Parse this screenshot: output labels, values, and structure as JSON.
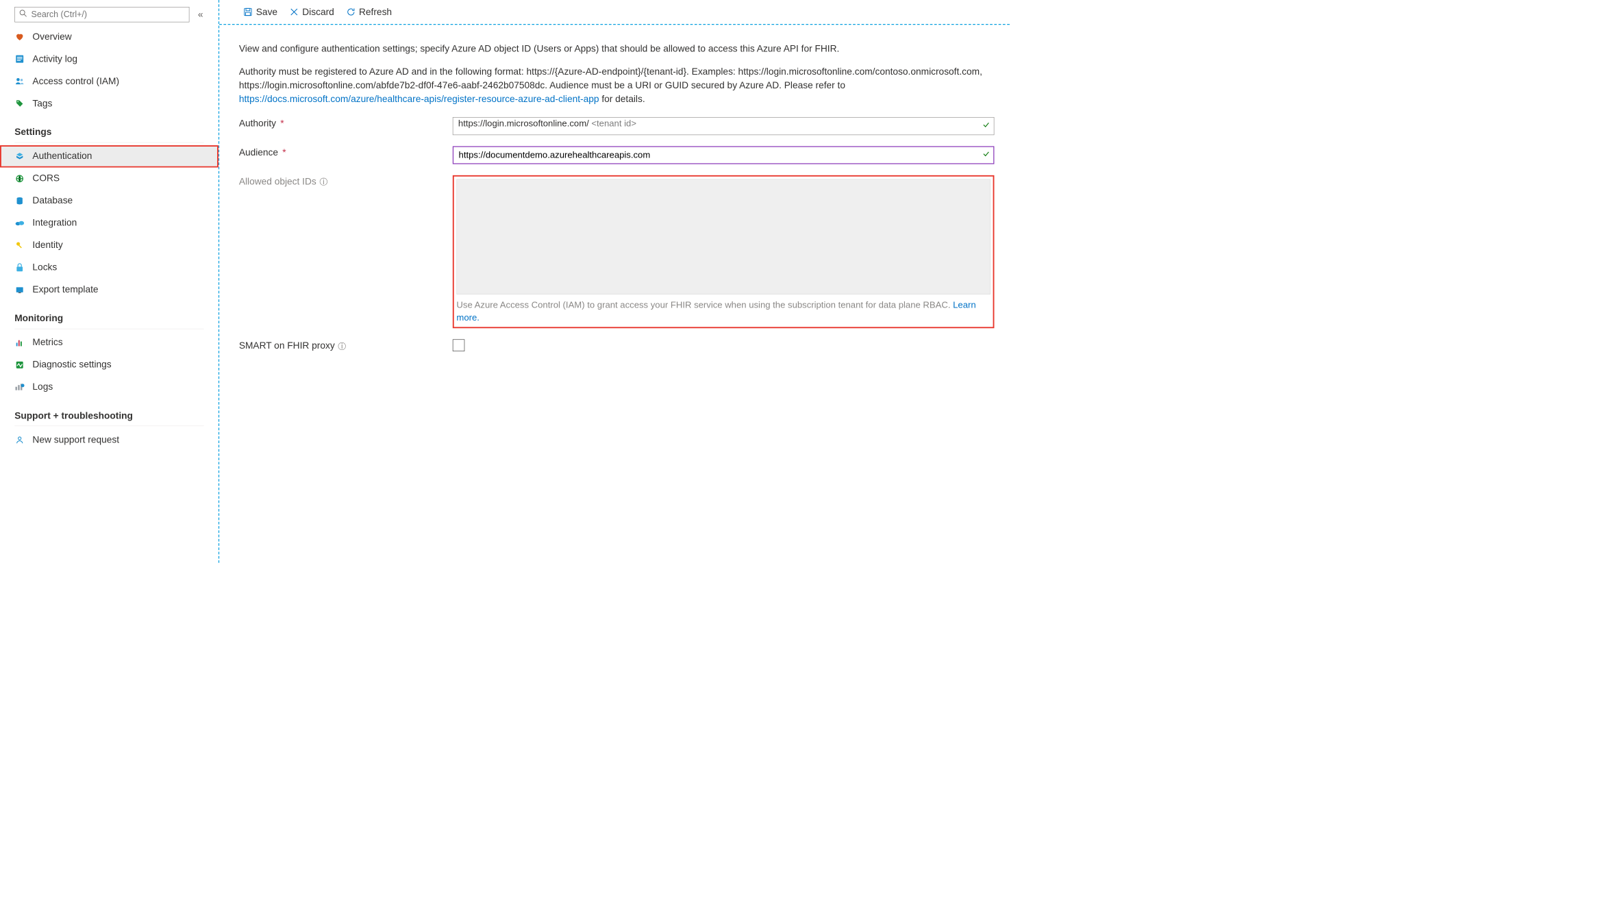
{
  "search": {
    "placeholder": "Search (Ctrl+/)"
  },
  "nav": {
    "top": [
      {
        "label": "Overview"
      },
      {
        "label": "Activity log"
      },
      {
        "label": "Access control (IAM)"
      },
      {
        "label": "Tags"
      }
    ],
    "settings_header": "Settings",
    "settings": [
      {
        "label": "Authentication"
      },
      {
        "label": "CORS"
      },
      {
        "label": "Database"
      },
      {
        "label": "Integration"
      },
      {
        "label": "Identity"
      },
      {
        "label": "Locks"
      },
      {
        "label": "Export template"
      }
    ],
    "monitoring_header": "Monitoring",
    "monitoring": [
      {
        "label": "Metrics"
      },
      {
        "label": "Diagnostic settings"
      },
      {
        "label": "Logs"
      }
    ],
    "support_header": "Support + troubleshooting",
    "support": [
      {
        "label": "New support request"
      }
    ]
  },
  "toolbar": {
    "save": "Save",
    "discard": "Discard",
    "refresh": "Refresh"
  },
  "intro1": "View and configure authentication settings; specify Azure AD object ID (Users or Apps) that should be allowed to access this Azure API for FHIR.",
  "intro2a": "Authority must be registered to Azure AD and in the following format: https://{Azure-AD-endpoint}/{tenant-id}. Examples: https://login.microsoftonline.com/contoso.onmicrosoft.com, https://login.microsoftonline.com/abfde7b2-df0f-47e6-aabf-2462b07508dc. Audience must be a URI or GUID secured by Azure AD. Please refer to ",
  "intro2link": "https://docs.microsoft.com/azure/healthcare-apis/register-resource-azure-ad-client-app",
  "intro2b": " for details.",
  "form": {
    "authority_label": "Authority",
    "authority_value_prefix": "https://login.microsoftonline.com/ ",
    "authority_value_hint": "<tenant id>",
    "audience_label": "Audience",
    "audience_value": "https://documentdemo.azurehealthcareapis.com",
    "allowed_label": "Allowed object IDs",
    "allowed_note_a": "Use Azure Access Control (IAM) to grant access your FHIR service when using the subscription tenant for data plane RBAC. ",
    "allowed_note_link": "Learn more.",
    "smart_label": "SMART on FHIR proxy"
  }
}
